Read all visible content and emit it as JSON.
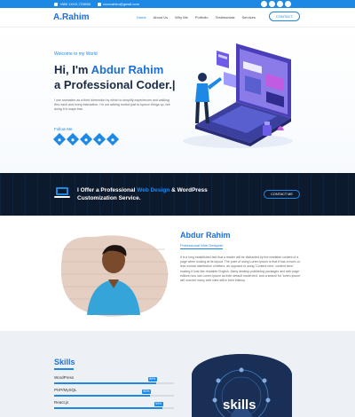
{
  "topbar": {
    "phone": "+880 1XXX-723600",
    "email": "xxxxxahim@gmail.com"
  },
  "nav": {
    "logo": "A.Rahim",
    "items": [
      "Home",
      "About Us",
      "Why Me",
      "Portfolio",
      "Testimonials",
      "Services"
    ],
    "cta": "CONTACT"
  },
  "hero": {
    "welcome": "Welcome to my World",
    "greeting": "Hi, I'm",
    "name": "Abdur Rahim",
    "subtitle": "a Professional Coder.|",
    "blurb": "I use animation as a third dimension by which to simplify experiences and walking thru each and every interaction. I'm not adding motion just to spruce things up, but doing it in ways that.",
    "follow_label": "Follow Me",
    "social_icons": [
      "facebook-icon",
      "twitter-icon",
      "linkedin-icon",
      "behance-icon",
      "dribbble-icon"
    ]
  },
  "banner": {
    "line1_prefix": "I Offer a Professional ",
    "line1_highlight": "Web Design",
    "line1_suffix": " & WordPress",
    "line2": "Customization Service.",
    "button": "CONTACT ME"
  },
  "about": {
    "name": "Abdur Rahim",
    "role": "Professional Web Designer",
    "text": "It is a long established fact that a reader will be distracted by the readable content of a page when looking at its layout. The point of using Lorem Ipsum is that it has a more-or-less normal distribution of letters, as opposed to using 'Content here, content here', making it look like readable English. Many desktop publishing packages and web page editors now use Lorem Ipsum as their default model text, and a search for 'lorem ipsum' will uncover many web sites still in their infancy."
  },
  "skills": {
    "title": "Skills",
    "items": [
      {
        "label": "WordPress",
        "percent": "85%",
        "value": 0.85
      },
      {
        "label": "PHP/MySQL",
        "percent": "80%",
        "value": 0.8
      },
      {
        "label": "React.js",
        "percent": "90%",
        "value": 0.9
      }
    ],
    "image_label": "skills"
  },
  "colors": {
    "accent": "#1e88e5",
    "dark": "#1a2a44",
    "banner_bg": "#0d1a2e"
  }
}
